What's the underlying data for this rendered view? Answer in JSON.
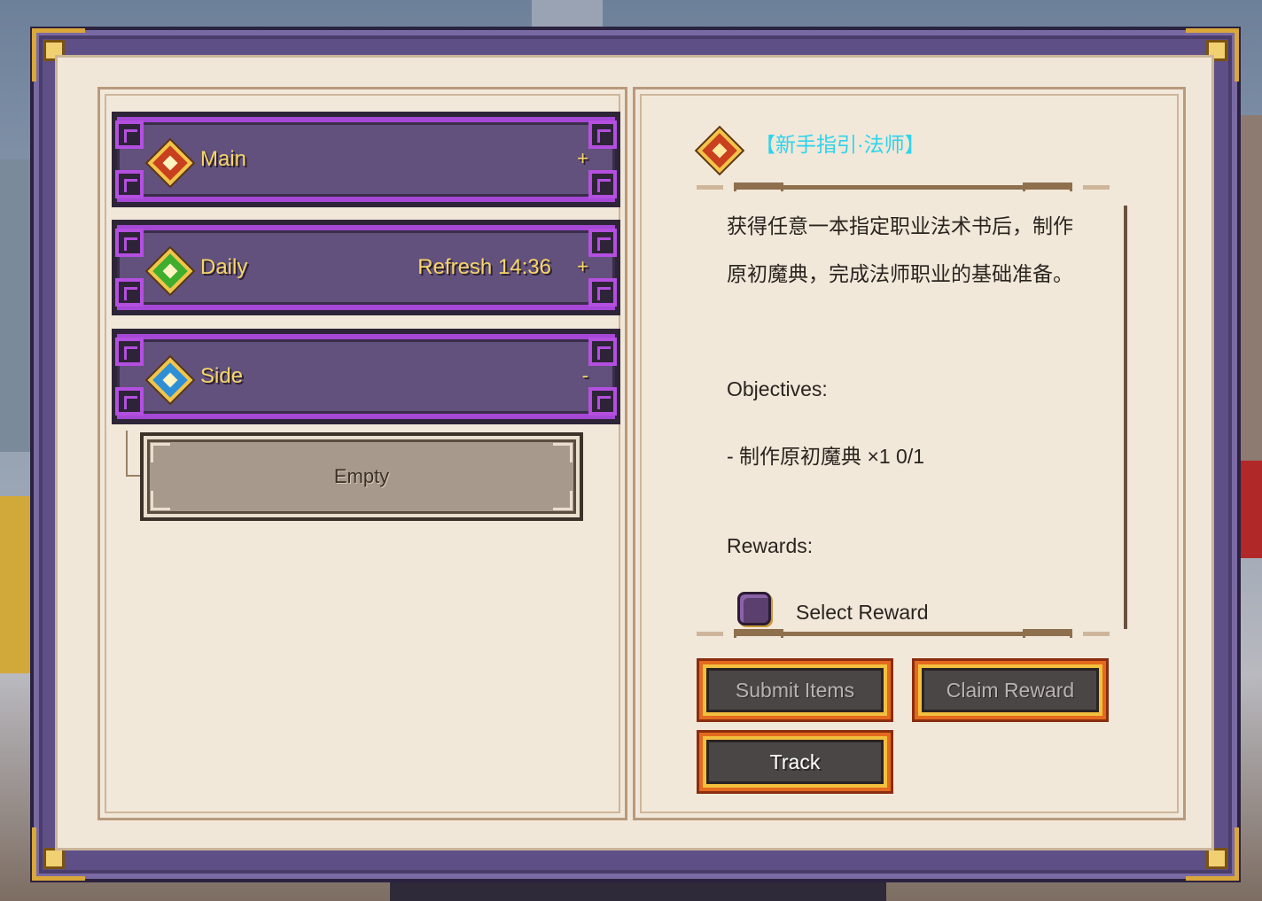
{
  "categories": [
    {
      "label": "Main",
      "extra": "",
      "toggle": "+",
      "gem": "red-gem-icon"
    },
    {
      "label": "Daily",
      "extra": "Refresh 14:36",
      "toggle": "+",
      "gem": "green-gem-icon"
    },
    {
      "label": "Side",
      "extra": "",
      "toggle": "-",
      "gem": "blue-gem-icon"
    }
  ],
  "side_entries": [
    {
      "label": "Empty"
    }
  ],
  "quest": {
    "title": "【新手指引·法师】",
    "description": "获得任意一本指定职业法术书后，制作原初魔典，完成法师职业的基础准备。",
    "objectives_heading": "Objectives:",
    "objective_line": "- 制作原初魔典 ×1 0/1",
    "rewards_heading": "Rewards:",
    "reward_label": "Select Reward"
  },
  "buttons": {
    "submit": "Submit Items",
    "claim": "Claim Reward",
    "track": "Track"
  },
  "colors": {
    "accent_purple": "#a548d6",
    "title_cyan": "#2ed3ec",
    "gold": "#f6d66a",
    "button_orange": "#e36a1e"
  }
}
